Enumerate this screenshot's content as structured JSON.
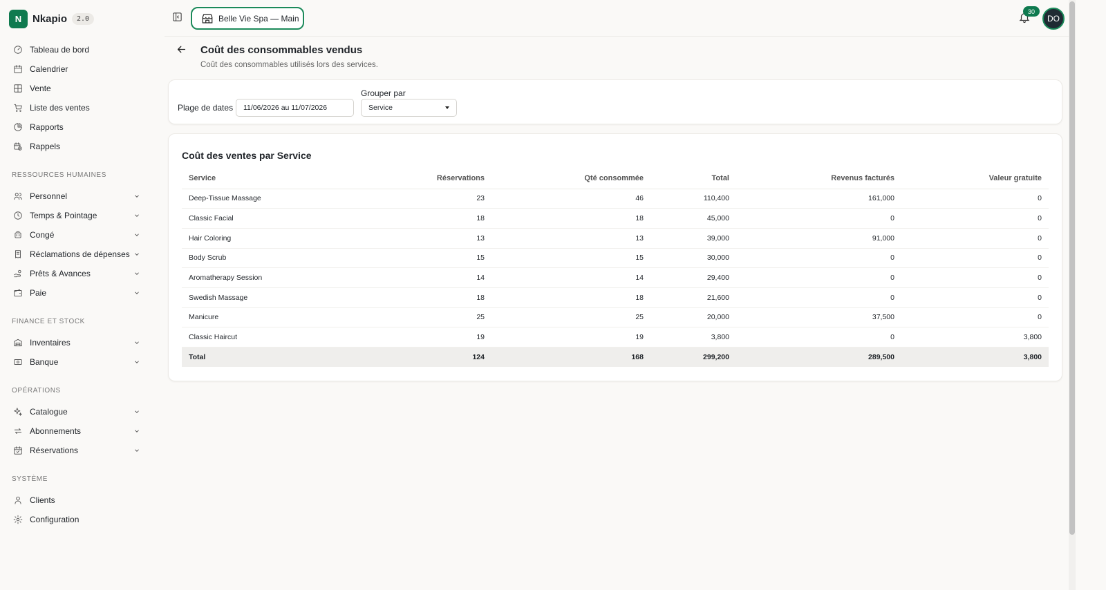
{
  "brand": {
    "logo_letter": "N",
    "name": "Nkapio",
    "version": "2.0"
  },
  "nav": {
    "top": [
      {
        "label": "Tableau de bord",
        "icon": "gauge-icon"
      },
      {
        "label": "Calendrier",
        "icon": "calendar-icon"
      },
      {
        "label": "Vente",
        "icon": "grid-icon"
      },
      {
        "label": "Liste des ventes",
        "icon": "cart-icon"
      },
      {
        "label": "Rapports",
        "icon": "pie-chart-icon"
      },
      {
        "label": "Rappels",
        "icon": "calendar-clock-icon"
      }
    ],
    "hr_title": "RESSOURCES HUMAINES",
    "hr": [
      {
        "label": "Personnel",
        "icon": "users-icon"
      },
      {
        "label": "Temps & Pointage",
        "icon": "clock-icon"
      },
      {
        "label": "Congé",
        "icon": "luggage-icon"
      },
      {
        "label": "Réclamations de dépenses",
        "icon": "receipt-icon"
      },
      {
        "label": "Prêts & Avances",
        "icon": "hand-coins-icon"
      },
      {
        "label": "Paie",
        "icon": "wallet-icon"
      }
    ],
    "finance_title": "FINANCE ET STOCK",
    "finance": [
      {
        "label": "Inventaires",
        "icon": "warehouse-icon"
      },
      {
        "label": "Banque",
        "icon": "banknote-icon"
      }
    ],
    "ops_title": "OPÉRATIONS",
    "ops": [
      {
        "label": "Catalogue",
        "icon": "sparkles-icon"
      },
      {
        "label": "Abonnements",
        "icon": "repeat-icon"
      },
      {
        "label": "Réservations",
        "icon": "calendar-check-icon"
      }
    ],
    "system_title": "SYSTÈME",
    "system": [
      {
        "label": "Clients",
        "icon": "user-icon"
      },
      {
        "label": "Configuration",
        "icon": "gear-icon"
      }
    ]
  },
  "topbar": {
    "store": "Belle Vie Spa — Main",
    "notifications": "30",
    "avatar": "DO"
  },
  "page": {
    "title": "Coût des consommables vendus",
    "subtitle": "Coût des consommables utilisés lors des services."
  },
  "filters": {
    "date_label": "Plage de dates",
    "date_value": "11/06/2026 au 11/07/2026",
    "group_label": "Grouper par",
    "group_value": "Service"
  },
  "report": {
    "title": "Coût des ventes par Service",
    "columns": [
      "Service",
      "Réservations",
      "Qté consommée",
      "Total",
      "Revenus facturés",
      "Valeur gratuite"
    ],
    "rows": [
      [
        "Deep-Tissue Massage",
        "23",
        "46",
        "110,400",
        "161,000",
        "0"
      ],
      [
        "Classic Facial",
        "18",
        "18",
        "45,000",
        "0",
        "0"
      ],
      [
        "Hair Coloring",
        "13",
        "13",
        "39,000",
        "91,000",
        "0"
      ],
      [
        "Body Scrub",
        "15",
        "15",
        "30,000",
        "0",
        "0"
      ],
      [
        "Aromatherapy Session",
        "14",
        "14",
        "29,400",
        "0",
        "0"
      ],
      [
        "Swedish Massage",
        "18",
        "18",
        "21,600",
        "0",
        "0"
      ],
      [
        "Manicure",
        "25",
        "25",
        "20,000",
        "37,500",
        "0"
      ],
      [
        "Classic Haircut",
        "19",
        "19",
        "3,800",
        "0",
        "3,800"
      ]
    ],
    "total": [
      "Total",
      "124",
      "168",
      "299,200",
      "289,500",
      "3,800"
    ]
  },
  "colors": {
    "brand": "#0f7a4f",
    "accent_border": "#1b8a5a",
    "avatar_bg": "#1f2a33"
  }
}
